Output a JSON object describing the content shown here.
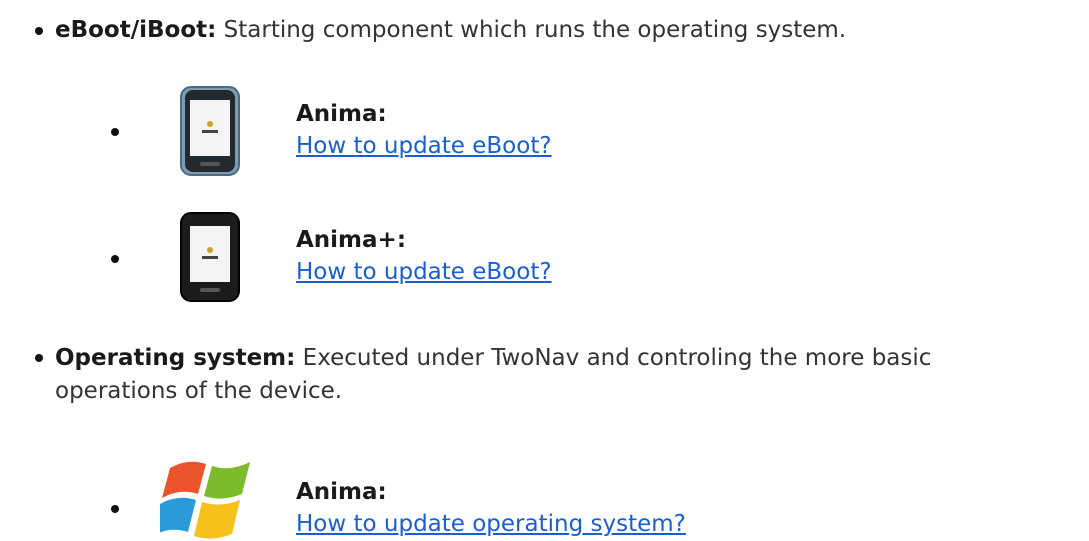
{
  "items": [
    {
      "term": "eBoot/iBoot:",
      "description": "Starting component which runs the operating system.",
      "subitems": [
        {
          "title": "Anima:",
          "link": "How to update eBoot?",
          "image": "anima-device-icon"
        },
        {
          "title": "Anima+:",
          "link": "How to update eBoot?",
          "image": "anima-plus-device-icon"
        }
      ]
    },
    {
      "term": "Operating system:",
      "description_line1": "Executed under TwoNav and controling the more basic",
      "description_line2": "operations of the device.",
      "subitems": [
        {
          "title": "Anima:",
          "link": "How to update operating system?",
          "image": "windows-logo-icon"
        }
      ]
    }
  ],
  "colors": {
    "link": "#1a5fd1",
    "text": "#333333",
    "anima_frame": "#6e8ea6",
    "anima_plus_frame": "#1c1c1c"
  }
}
